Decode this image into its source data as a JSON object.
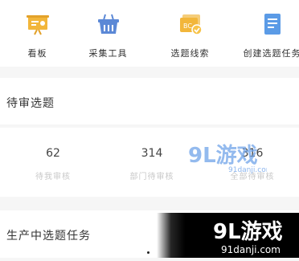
{
  "tools": [
    {
      "label": "看板",
      "icon": "dashboard-board-icon",
      "color": "#f2b63a"
    },
    {
      "label": "采集工具",
      "icon": "basket-icon",
      "color": "#5b88d6"
    },
    {
      "label": "选题线索",
      "icon": "topic-clue-icon",
      "color": "#f2b63a"
    },
    {
      "label": "创建选题任务",
      "icon": "document-icon",
      "color": "#5b9be6"
    }
  ],
  "review_section": {
    "title": "待审选题",
    "stats": [
      {
        "value": "62",
        "caption": "待我审核"
      },
      {
        "value": "314",
        "caption": "部门待审核"
      },
      {
        "value": "316",
        "caption": "全部待审核"
      }
    ]
  },
  "production_section": {
    "title": "生产中选题任务"
  },
  "watermarks": {
    "small_logo": "9L游戏",
    "small_url": "91danji.com",
    "large_logo": "9L游戏",
    "large_url": "91danji.com"
  }
}
